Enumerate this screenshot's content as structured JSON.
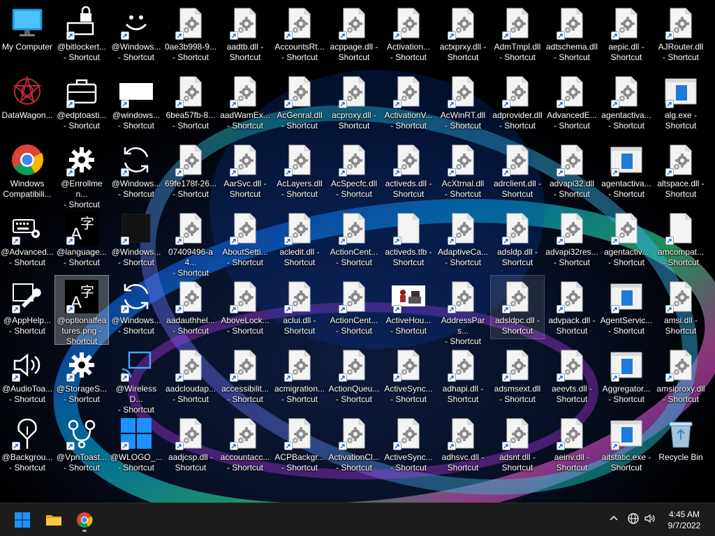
{
  "desktop": {
    "icons": [
      {
        "col": 0,
        "row": 0,
        "type": "monitor",
        "label": "My Computer",
        "shortcut": false
      },
      {
        "col": 0,
        "row": 1,
        "type": "datawagon",
        "label": "DataWagon...",
        "shortcut": false
      },
      {
        "col": 0,
        "row": 2,
        "type": "chrome",
        "label": "Windows\nCompatibili...",
        "shortcut": false
      },
      {
        "col": 0,
        "row": 3,
        "type": "keyboard-gear",
        "label": "@Advanced...\n- Shortcut",
        "shortcut": true
      },
      {
        "col": 0,
        "row": 4,
        "type": "wrench",
        "label": "@AppHelp...\n- Shortcut",
        "shortcut": true
      },
      {
        "col": 0,
        "row": 5,
        "type": "speaker",
        "label": "@AudioToa...\n- Shortcut",
        "shortcut": true
      },
      {
        "col": 0,
        "row": 6,
        "type": "pin",
        "label": "@Backgrou...\n- Shortcut",
        "shortcut": true
      },
      {
        "col": 1,
        "row": 0,
        "type": "lock",
        "label": "@bitlockert...\n- Shortcut",
        "shortcut": true
      },
      {
        "col": 1,
        "row": 1,
        "type": "briefcase",
        "label": "@edptoasti...\n- Shortcut",
        "shortcut": true
      },
      {
        "col": 1,
        "row": 2,
        "type": "gear",
        "label": "@Enrollmen...\n- Shortcut",
        "shortcut": true
      },
      {
        "col": 1,
        "row": 3,
        "type": "language",
        "label": "@language...\n- Shortcut",
        "shortcut": true
      },
      {
        "col": 1,
        "row": 4,
        "type": "language",
        "label": "@optionalfea\ntures.png -\nShortcut",
        "shortcut": true,
        "selected": true
      },
      {
        "col": 1,
        "row": 5,
        "type": "gear",
        "label": "@StorageS...\n- Shortcut",
        "shortcut": true
      },
      {
        "col": 1,
        "row": 6,
        "type": "vpn",
        "label": "@VpnToast...\n- Shortcut",
        "shortcut": true
      },
      {
        "col": 2,
        "row": 0,
        "type": "smiley",
        "label": "@Windows...\n- Shortcut",
        "shortcut": true
      },
      {
        "col": 2,
        "row": 1,
        "type": "white-rect",
        "label": "@windows...\n- Shortcut",
        "shortcut": true
      },
      {
        "col": 2,
        "row": 2,
        "type": "refresh",
        "label": "@Windows...\n- Shortcut",
        "shortcut": true
      },
      {
        "col": 2,
        "row": 3,
        "type": "dark-square",
        "label": "@Windows...\n- Shortcut",
        "shortcut": true
      },
      {
        "col": 2,
        "row": 4,
        "type": "refresh",
        "label": "@Windows...\n- Shortcut",
        "shortcut": true
      },
      {
        "col": 2,
        "row": 5,
        "type": "cast",
        "label": "@WirelessD...\n- Shortcut",
        "shortcut": true
      },
      {
        "col": 2,
        "row": 6,
        "type": "winlogo",
        "label": "@WLOGO_...\n- Shortcut",
        "shortcut": true
      },
      {
        "col": 3,
        "row": 0,
        "type": "dll",
        "label": "0ae3b998-9...\n- Shortcut",
        "shortcut": true
      },
      {
        "col": 3,
        "row": 1,
        "type": "dll",
        "label": "6bea57fb-8...\n- Shortcut",
        "shortcut": true
      },
      {
        "col": 3,
        "row": 2,
        "type": "dll",
        "label": "69fe178f-26...\n- Shortcut",
        "shortcut": true
      },
      {
        "col": 3,
        "row": 3,
        "type": "dll",
        "label": "07409496-a4...\n- Shortcut",
        "shortcut": true
      },
      {
        "col": 3,
        "row": 4,
        "type": "dll",
        "label": "aadauthhel...\n- Shortcut",
        "shortcut": true
      },
      {
        "col": 3,
        "row": 5,
        "type": "dll",
        "label": "aadcloudap...\n- Shortcut",
        "shortcut": true
      },
      {
        "col": 3,
        "row": 6,
        "type": "dll",
        "label": "aadjcsp.dll -\nShortcut",
        "shortcut": true
      },
      {
        "col": 4,
        "row": 0,
        "type": "dll",
        "label": "aadtb.dll -\nShortcut",
        "shortcut": true
      },
      {
        "col": 4,
        "row": 1,
        "type": "dll",
        "label": "aadWamEx...\n- Shortcut",
        "shortcut": true
      },
      {
        "col": 4,
        "row": 2,
        "type": "dll",
        "label": "AarSvc.dll -\nShortcut",
        "shortcut": true
      },
      {
        "col": 4,
        "row": 3,
        "type": "dll",
        "label": "AboutSetti...\n- Shortcut",
        "shortcut": true
      },
      {
        "col": 4,
        "row": 4,
        "type": "dll",
        "label": "AboveLock...\n- Shortcut",
        "shortcut": true
      },
      {
        "col": 4,
        "row": 5,
        "type": "dll",
        "label": "accessibilit...\n- Shortcut",
        "shortcut": true
      },
      {
        "col": 4,
        "row": 6,
        "type": "dll",
        "label": "accountacc...\n- Shortcut",
        "shortcut": true
      },
      {
        "col": 5,
        "row": 0,
        "type": "dll",
        "label": "AccountsRt...\n- Shortcut",
        "shortcut": true
      },
      {
        "col": 5,
        "row": 1,
        "type": "dll",
        "label": "AcGenral.dll\n- Shortcut",
        "shortcut": true
      },
      {
        "col": 5,
        "row": 2,
        "type": "dll",
        "label": "AcLayers.dll\n- Shortcut",
        "shortcut": true
      },
      {
        "col": 5,
        "row": 3,
        "type": "dll",
        "label": "acledit.dll -\nShortcut",
        "shortcut": true
      },
      {
        "col": 5,
        "row": 4,
        "type": "dll",
        "label": "aclui.dll -\nShortcut",
        "shortcut": true
      },
      {
        "col": 5,
        "row": 5,
        "type": "dll",
        "label": "acmigration...\n- Shortcut",
        "shortcut": true
      },
      {
        "col": 5,
        "row": 6,
        "type": "dll",
        "label": "ACPBackgr...\n- Shortcut",
        "shortcut": true
      },
      {
        "col": 6,
        "row": 0,
        "type": "dll",
        "label": "acppage.dll -\nShortcut",
        "shortcut": true
      },
      {
        "col": 6,
        "row": 1,
        "type": "dll",
        "label": "acproxy.dll -\nShortcut",
        "shortcut": true
      },
      {
        "col": 6,
        "row": 2,
        "type": "dll",
        "label": "AcSpecfc.dll\n- Shortcut",
        "shortcut": true
      },
      {
        "col": 6,
        "row": 3,
        "type": "dll",
        "label": "ActionCent...\n- Shortcut",
        "shortcut": true
      },
      {
        "col": 6,
        "row": 4,
        "type": "dll",
        "label": "ActionCent...\n- Shortcut",
        "shortcut": true
      },
      {
        "col": 6,
        "row": 5,
        "type": "dll",
        "label": "ActionQueu...\n- Shortcut",
        "shortcut": true
      },
      {
        "col": 6,
        "row": 6,
        "type": "dll",
        "label": "ActivationCl...\n- Shortcut",
        "shortcut": true
      },
      {
        "col": 7,
        "row": 0,
        "type": "dll",
        "label": "Activation...\n- Shortcut",
        "shortcut": true
      },
      {
        "col": 7,
        "row": 1,
        "type": "dll",
        "label": "ActivationV...\n- Shortcut",
        "shortcut": true
      },
      {
        "col": 7,
        "row": 2,
        "type": "dll",
        "label": "activeds.dll -\nShortcut",
        "shortcut": true
      },
      {
        "col": 7,
        "row": 3,
        "type": "blank",
        "label": "activeds.tlb -\nShortcut",
        "shortcut": true
      },
      {
        "col": 7,
        "row": 4,
        "type": "photo",
        "label": "ActiveHou...\n- Shortcut",
        "shortcut": true
      },
      {
        "col": 7,
        "row": 5,
        "type": "dll",
        "label": "ActiveSync...\n- Shortcut",
        "shortcut": true
      },
      {
        "col": 7,
        "row": 6,
        "type": "dll",
        "label": "ActiveSync...\n- Shortcut",
        "shortcut": true
      },
      {
        "col": 8,
        "row": 0,
        "type": "dll",
        "label": "actxprxy.dll -\nShortcut",
        "shortcut": true
      },
      {
        "col": 8,
        "row": 1,
        "type": "dll",
        "label": "AcWinRT.dll\n- Shortcut",
        "shortcut": true
      },
      {
        "col": 8,
        "row": 2,
        "type": "dll",
        "label": "AcXtrnal.dll\n- Shortcut",
        "shortcut": true
      },
      {
        "col": 8,
        "row": 3,
        "type": "dll",
        "label": "AdaptiveCa...\n- Shortcut",
        "shortcut": true
      },
      {
        "col": 8,
        "row": 4,
        "type": "dll",
        "label": "AddressPars...\n- Shortcut",
        "shortcut": true
      },
      {
        "col": 8,
        "row": 5,
        "type": "dll",
        "label": "adhapi.dll -\nShortcut",
        "shortcut": true
      },
      {
        "col": 8,
        "row": 6,
        "type": "dll",
        "label": "adhsvc.dll -\nShortcut",
        "shortcut": true
      },
      {
        "col": 9,
        "row": 0,
        "type": "dll",
        "label": "AdmTmpl.dll\n- Shortcut",
        "shortcut": true
      },
      {
        "col": 9,
        "row": 1,
        "type": "dll",
        "label": "adprovider.dll\n- Shortcut",
        "shortcut": true
      },
      {
        "col": 9,
        "row": 2,
        "type": "dll",
        "label": "adrclient.dll -\nShortcut",
        "shortcut": true
      },
      {
        "col": 9,
        "row": 3,
        "type": "dll",
        "label": "adsldp.dll -\nShortcut",
        "shortcut": true
      },
      {
        "col": 9,
        "row": 4,
        "type": "dll",
        "label": "adsldpc.dll -\nShortcut",
        "shortcut": true,
        "hover": true
      },
      {
        "col": 9,
        "row": 5,
        "type": "dll",
        "label": "adsmsext.dll\n- Shortcut",
        "shortcut": true
      },
      {
        "col": 9,
        "row": 6,
        "type": "dll",
        "label": "adsnt.dll -\nShortcut",
        "shortcut": true
      },
      {
        "col": 10,
        "row": 0,
        "type": "dll",
        "label": "adtschema.dll\n- Shortcut",
        "shortcut": true
      },
      {
        "col": 10,
        "row": 1,
        "type": "dll",
        "label": "AdvancedE...\n- Shortcut",
        "shortcut": true
      },
      {
        "col": 10,
        "row": 2,
        "type": "dll",
        "label": "advapi32.dll\n- Shortcut",
        "shortcut": true
      },
      {
        "col": 10,
        "row": 3,
        "type": "dll",
        "label": "advapi32res...\n- Shortcut",
        "shortcut": true
      },
      {
        "col": 10,
        "row": 4,
        "type": "dll",
        "label": "advpack.dll -\nShortcut",
        "shortcut": true
      },
      {
        "col": 10,
        "row": 5,
        "type": "dll",
        "label": "aeevts.dll -\nShortcut",
        "shortcut": true
      },
      {
        "col": 10,
        "row": 6,
        "type": "dll",
        "label": "aeinv.dll -\nShortcut",
        "shortcut": true
      },
      {
        "col": 11,
        "row": 0,
        "type": "dll",
        "label": "aepic.dll -\nShortcut",
        "shortcut": true
      },
      {
        "col": 11,
        "row": 1,
        "type": "dll",
        "label": "agentactiva...\n- Shortcut",
        "shortcut": true
      },
      {
        "col": 11,
        "row": 2,
        "type": "exe",
        "label": "agentactiva...\n- Shortcut",
        "shortcut": true
      },
      {
        "col": 11,
        "row": 3,
        "type": "dll",
        "label": "agentactiv...\n- Shortcut",
        "shortcut": true
      },
      {
        "col": 11,
        "row": 4,
        "type": "exe",
        "label": "AgentServic...\n- Shortcut",
        "shortcut": true
      },
      {
        "col": 11,
        "row": 5,
        "type": "exe",
        "label": "Aggregator...\n- Shortcut",
        "shortcut": true
      },
      {
        "col": 11,
        "row": 6,
        "type": "exe",
        "label": "aitstatic.exe -\nShortcut",
        "shortcut": true
      },
      {
        "col": 12,
        "row": 0,
        "type": "dll",
        "label": "AJRouter.dll\n- Shortcut",
        "shortcut": true
      },
      {
        "col": 12,
        "row": 1,
        "type": "exe",
        "label": "alg.exe -\nShortcut",
        "shortcut": true
      },
      {
        "col": 12,
        "row": 2,
        "type": "dll",
        "label": "altspace.dll -\nShortcut",
        "shortcut": true
      },
      {
        "col": 12,
        "row": 3,
        "type": "blank",
        "label": "amcompat...\n- Shortcut",
        "shortcut": true
      },
      {
        "col": 12,
        "row": 4,
        "type": "dll",
        "label": "amsi.dll -\nShortcut",
        "shortcut": true
      },
      {
        "col": 12,
        "row": 5,
        "type": "dll",
        "label": "amsiproxy.dll\n- Shortcut",
        "shortcut": true
      },
      {
        "col": 12,
        "row": 6,
        "type": "recycle",
        "label": "Recycle Bin",
        "shortcut": false
      }
    ]
  },
  "taskbar": {
    "start_icon": "windows-start-icon",
    "pinned": [
      {
        "name": "file-explorer",
        "icon": "folder-icon"
      },
      {
        "name": "chrome",
        "icon": "chrome-icon",
        "running": true
      }
    ],
    "tray_icons": [
      "chevron-up-icon",
      "network-globe-icon",
      "volume-icon"
    ],
    "clock": {
      "time": "4:45 AM",
      "date": "9/7/2022"
    }
  },
  "colors": {
    "taskbar": "#1c1c1c",
    "accent": "#0078d4",
    "selection": "rgba(255,255,255,0.25)"
  }
}
